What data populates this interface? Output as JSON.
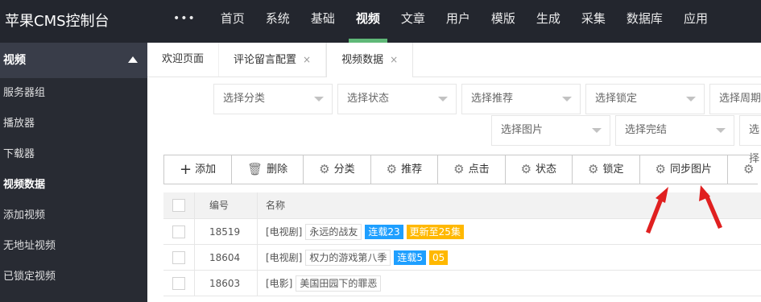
{
  "app": {
    "title": "苹果CMS控制台"
  },
  "topnav": {
    "more_label": "•••",
    "items": [
      "首页",
      "系统",
      "基础",
      "视频",
      "文章",
      "用户",
      "模版",
      "生成",
      "采集",
      "数据库",
      "应用"
    ],
    "active": "视频"
  },
  "sidebar": {
    "section": "视频",
    "items": [
      "服务器组",
      "播放器",
      "下载器",
      "视频数据",
      "添加视频",
      "无地址视频",
      "已锁定视频"
    ],
    "active": "视频数据"
  },
  "tabs": [
    {
      "label": "欢迎页面",
      "closable": false
    },
    {
      "label": "评论留言配置",
      "closable": true
    },
    {
      "label": "视频数据",
      "closable": true,
      "active": true
    }
  ],
  "tab_close_glyph": "×",
  "filters": {
    "row1": [
      "选择分类",
      "选择状态",
      "选择推荐",
      "选择锁定",
      "选择周期"
    ],
    "row2": [
      "选择图片",
      "选择完结",
      "选择"
    ]
  },
  "toolbar": {
    "buttons": [
      {
        "label": "添加",
        "icon": "plus-icon",
        "glyph": "+"
      },
      {
        "label": "删除",
        "icon": "trash-icon",
        "glyph": "🗑"
      },
      {
        "label": "分类",
        "icon": "gear-icon",
        "glyph": "⚙"
      },
      {
        "label": "推荐",
        "icon": "gear-icon",
        "glyph": "⚙"
      },
      {
        "label": "点击",
        "icon": "gear-icon",
        "glyph": "⚙"
      },
      {
        "label": "状态",
        "icon": "gear-icon",
        "glyph": "⚙"
      },
      {
        "label": "锁定",
        "icon": "gear-icon",
        "glyph": "⚙"
      },
      {
        "label": "同步图片",
        "icon": "gear-icon",
        "glyph": "⚙"
      },
      {
        "label": "",
        "icon": "gear-icon",
        "glyph": "⚙"
      }
    ]
  },
  "table": {
    "headers": {
      "id": "编号",
      "name": "名称"
    },
    "rows": [
      {
        "id": "18519",
        "category": "[电视剧]",
        "title": "永远的战友",
        "badges": [
          {
            "text": "连载23",
            "color": "blue"
          },
          {
            "text": "更新至25集",
            "color": "orange"
          }
        ]
      },
      {
        "id": "18604",
        "category": "[电视剧]",
        "title": "权力的游戏第八季",
        "badges": [
          {
            "text": "连载5",
            "color": "blue"
          },
          {
            "text": "05",
            "color": "orange"
          }
        ]
      },
      {
        "id": "18603",
        "category": "[电影]",
        "title": "美国田园下的罪恶",
        "badges": []
      }
    ]
  },
  "colors": {
    "topbar": "#23262e",
    "sidebar": "#282b33",
    "accent_green": "#5fb878",
    "badge_blue": "#1e9fff",
    "badge_orange": "#ffb800",
    "annotation_red": "#e02020"
  }
}
